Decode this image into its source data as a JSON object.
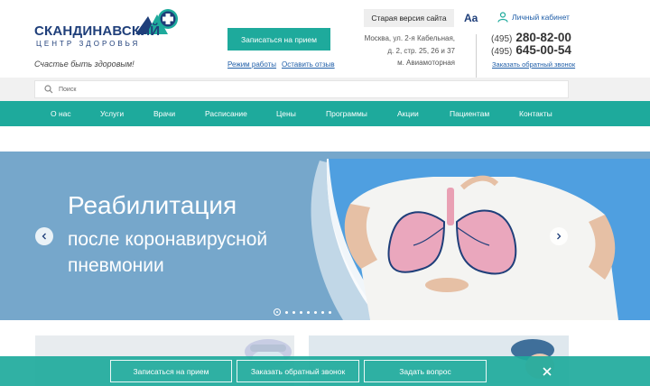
{
  "header": {
    "logo": {
      "name": "СКАНДИНАВСКИЙ",
      "subtitle": "ЦЕНТР ЗДОРОВЬЯ",
      "colors": {
        "dark": "#1f3f7a",
        "teal": "#1eaa9c"
      }
    },
    "slogan": "Счастье быть здоровым!",
    "appointment_button": "Записаться на прием",
    "links": {
      "hours": "Режим работы",
      "reviews": "Оставить отзыв"
    },
    "old_site_button": "Старая версия сайта",
    "font_size_toggle": "Aa",
    "address": [
      "Москва, ул. 2-я Кабельная,",
      "д. 2, стр. 25, 26 и 37",
      "м. Авиамоторная"
    ],
    "account_link": "Личный кабинет",
    "phones": [
      {
        "code": "(495)",
        "number": "280-82-00"
      },
      {
        "code": "(495)",
        "number": "645-00-54"
      }
    ],
    "callback_link": "Заказать обратный звонок"
  },
  "search": {
    "placeholder": "Поиск"
  },
  "nav": {
    "items": [
      "О нас",
      "Услуги",
      "Врачи",
      "Расписание",
      "Цены",
      "Программы",
      "Акции",
      "Пациентам",
      "Контакты"
    ]
  },
  "hero": {
    "title": "Реабилитация",
    "subtitle_line1": "после коронавирусной",
    "subtitle_line2": "пневмонии",
    "slide_count": 8,
    "active_slide": 1,
    "background_color": "#76a7cb"
  },
  "bottom_bar": {
    "buttons": [
      "Записаться на прием",
      "Заказать обратный звонок",
      "Задать вопрос"
    ],
    "close_icon": "close-icon",
    "color": "#1eaa9c"
  }
}
